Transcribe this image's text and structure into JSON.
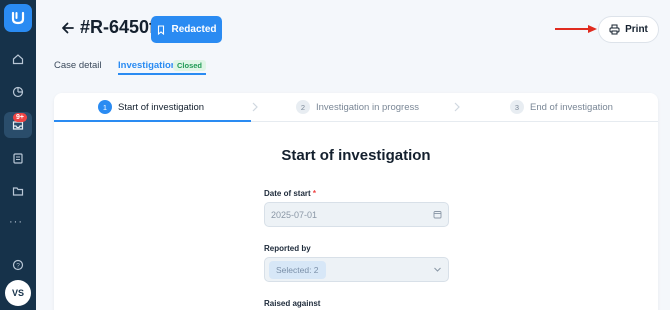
{
  "sidebar": {
    "badge": "9+",
    "avatar_initials": "VS",
    "more_label": "···"
  },
  "header": {
    "case_id": "#R-6450f",
    "redacted_label": "Redacted",
    "print_label": "Print"
  },
  "tabs": [
    {
      "label": "Case detail",
      "active": false
    },
    {
      "label": "Investigation",
      "active": true,
      "status": "Closed"
    }
  ],
  "steps": [
    {
      "number": "1",
      "label": "Start of investigation",
      "active": true
    },
    {
      "number": "2",
      "label": "Investigation in progress",
      "active": false
    },
    {
      "number": "3",
      "label": "End of investigation",
      "active": false
    }
  ],
  "form": {
    "title": "Start of investigation",
    "date_label": "Date of start",
    "date_required": "*",
    "date_value": "2025-07-01",
    "reported_by_label": "Reported by",
    "reported_by_value": "Selected: 2",
    "raised_against_label": "Raised against"
  },
  "colors": {
    "accent": "#2a8bf2",
    "sidebar": "#16324a",
    "closed_badge": "#1e9a54",
    "arrow": "#e02b1f"
  }
}
